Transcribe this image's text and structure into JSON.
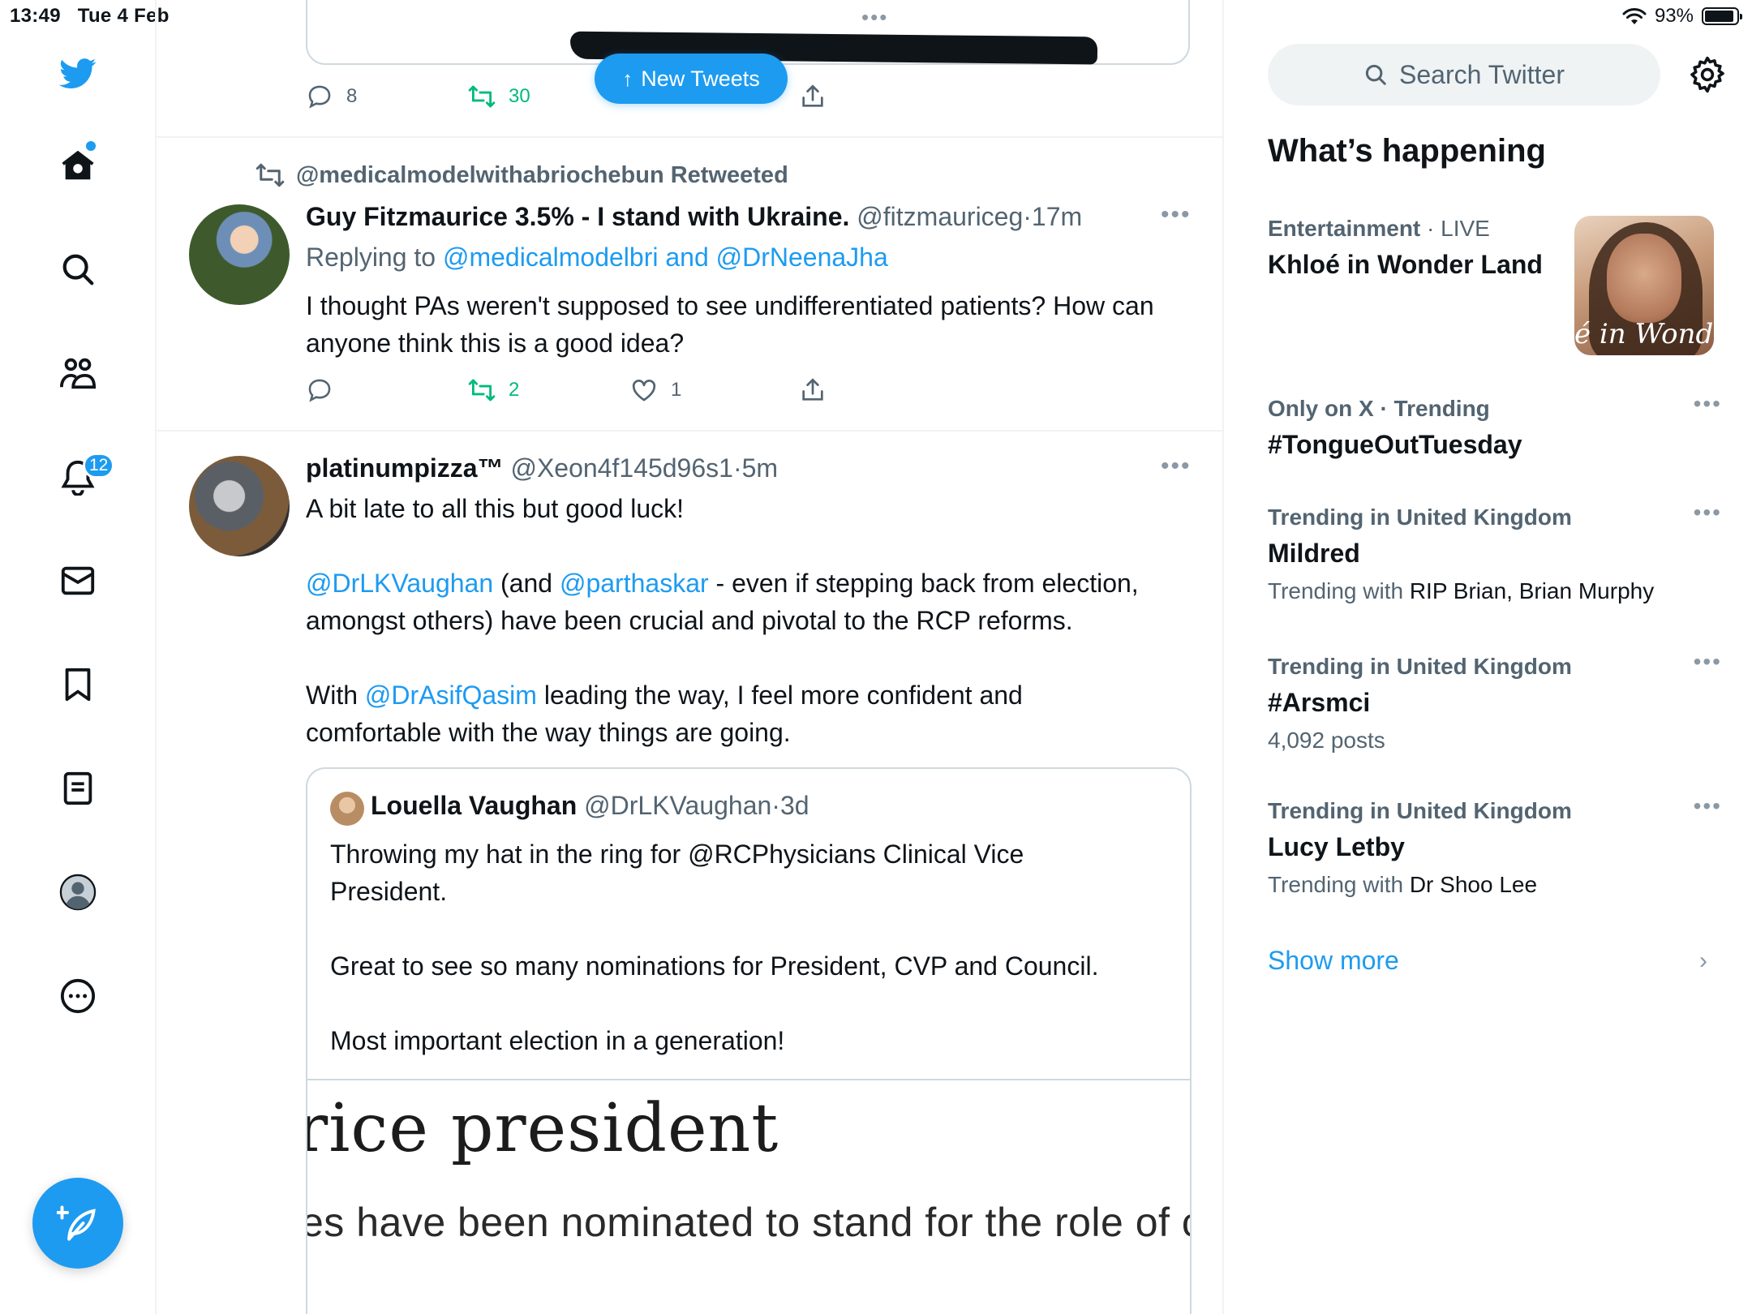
{
  "status_bar": {
    "time": "13:49",
    "date": "Tue 4 Feb",
    "battery": "93%"
  },
  "nav": {
    "notifications_badge": "12",
    "items": [
      "home",
      "explore",
      "communities",
      "notifications",
      "messages",
      "bookmarks",
      "lists",
      "profile",
      "more"
    ]
  },
  "new_tweets_label": "New Tweets",
  "prev_tweet": {
    "replies": "8",
    "retweets": "30"
  },
  "tweet1": {
    "retweeted_by": "@medicalmodelwithabriochebun Retweeted",
    "name": "Guy Fitzmaurice 3.5% - I stand with Ukraine.",
    "handle": "@fitzmauriceg",
    "sep": "·",
    "time": "17m",
    "replying_prefix": "Replying to",
    "replying_user1": "@medicalmodelbri",
    "replying_and": "and",
    "replying_user2": "@DrNeenaJha",
    "text": "I thought PAs weren't supposed to see undifferentiated patients? How can anyone think this is a good idea?",
    "retweets": "2",
    "likes": "1"
  },
  "tweet2": {
    "name": "platinumpizza™",
    "handle": "@Xeon4f145d96s1",
    "sep": "·",
    "time": "5m",
    "line1": "A bit late to all this but good luck!",
    "mention1": "@DrLKVaughan",
    "and_text": " (and ",
    "mention2": "@parthaskar",
    "para2_rest": " - even if stepping back from election, amongst others) have been crucial and pivotal to the RCP reforms.",
    "with_text": "With ",
    "mention3": "@DrAsifQasim",
    "para3_rest": " leading the way, I feel more confident and comfortable with the way things are going.",
    "quote": {
      "name": "Louella Vaughan",
      "handle": "@DrLKVaughan",
      "sep": "·",
      "time": "3d",
      "p1": "Throwing my hat in the ring for @RCPhysicians Clinical Vice President.",
      "p2": "Great to see so many nominations for President, CVP and Council.",
      "p3": "Most important election in a generation!",
      "image_line1": "rice president",
      "image_line2": "es have been nominated to stand for the role of clin"
    }
  },
  "right": {
    "search_placeholder": "Search Twitter",
    "title": "What’s happening",
    "trends": [
      {
        "category": "Entertainment",
        "sep": " · ",
        "live": "LIVE",
        "topic": "Khloé in Wonder Land",
        "image_text": "é in Wonder L"
      },
      {
        "category": "Only on X · Trending",
        "topic": "#TongueOutTuesday"
      },
      {
        "category": "Trending in United Kingdom",
        "topic": "Mildred",
        "sub_prefix": "Trending with ",
        "sub_value": "RIP Brian, Brian Murphy"
      },
      {
        "category": "Trending in United Kingdom",
        "topic": "#Arsmci",
        "sub_prefix": "4,092 posts"
      },
      {
        "category": "Trending in United Kingdom",
        "topic": "Lucy Letby",
        "sub_prefix": "Trending with ",
        "sub_value": "Dr Shoo Lee"
      }
    ],
    "show_more": "Show more",
    "more_dots": "•••"
  },
  "colors": {
    "accent": "#1d9bf0",
    "retweet_green": "#00ba7c",
    "muted": "#536471"
  }
}
